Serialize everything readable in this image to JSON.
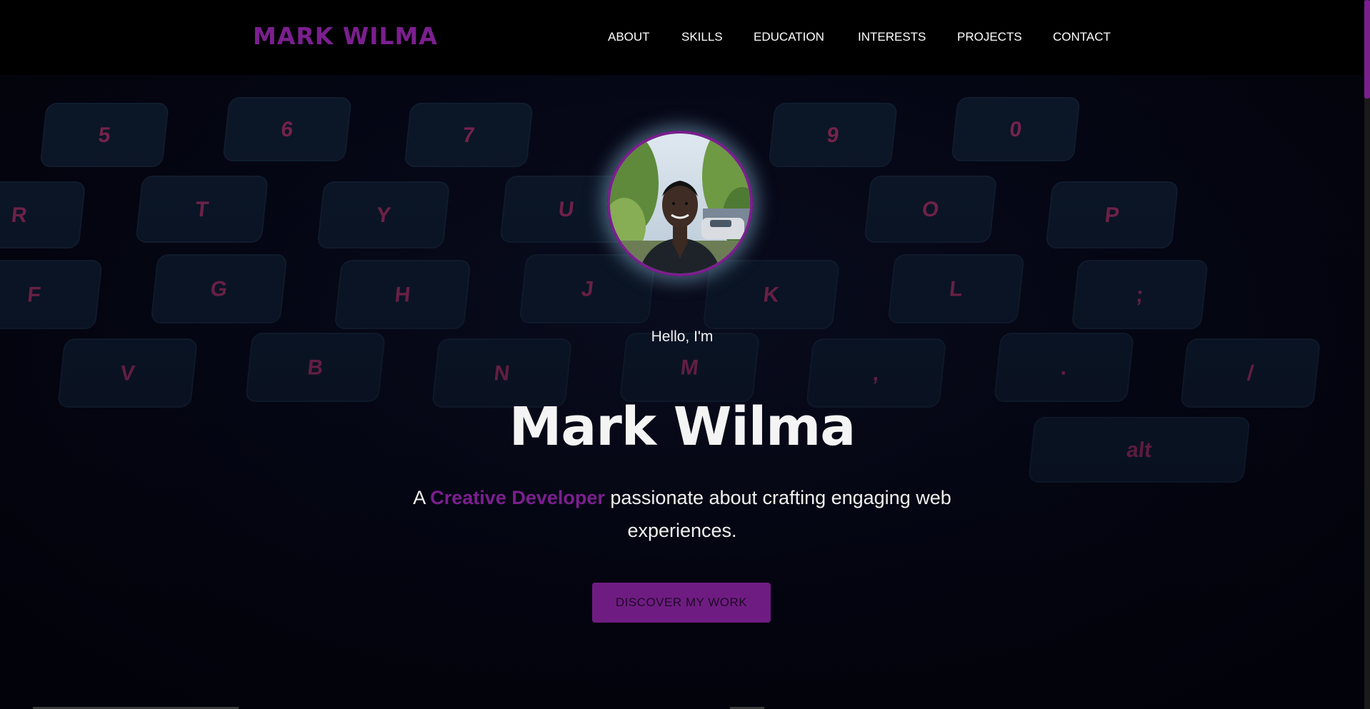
{
  "header": {
    "logo": "MARK WILMA",
    "nav": [
      {
        "label": "ABOUT"
      },
      {
        "label": "SKILLS"
      },
      {
        "label": "EDUCATION"
      },
      {
        "label": "INTERESTS"
      },
      {
        "label": "PROJECTS"
      },
      {
        "label": "CONTACT"
      }
    ]
  },
  "hero": {
    "greeting": "Hello, I'm",
    "name": "Mark Wilma",
    "tagline": {
      "before": "A ",
      "accent": "Creative Developer",
      "after": " passionate about crafting engaging web experiences."
    },
    "cta_label": "DISCOVER MY WORK"
  },
  "colors": {
    "accent": "#7b1f8f",
    "cta_background": "#6f1c82",
    "header_background": "#000000",
    "text": "#f4f4f4"
  },
  "icons": [
    "avatar-photo",
    "keyboard-background"
  ],
  "keyboard": {
    "rows": [
      [
        "5",
        "6",
        "7",
        "9",
        "0"
      ],
      [
        "R",
        "T",
        "Y",
        "U",
        "O",
        "P"
      ],
      [
        "F",
        "G",
        "H",
        "J",
        "K",
        "L",
        ";"
      ],
      [
        "V",
        "B",
        "N",
        "M",
        ",",
        ".",
        "/"
      ],
      [
        "alt"
      ]
    ]
  }
}
